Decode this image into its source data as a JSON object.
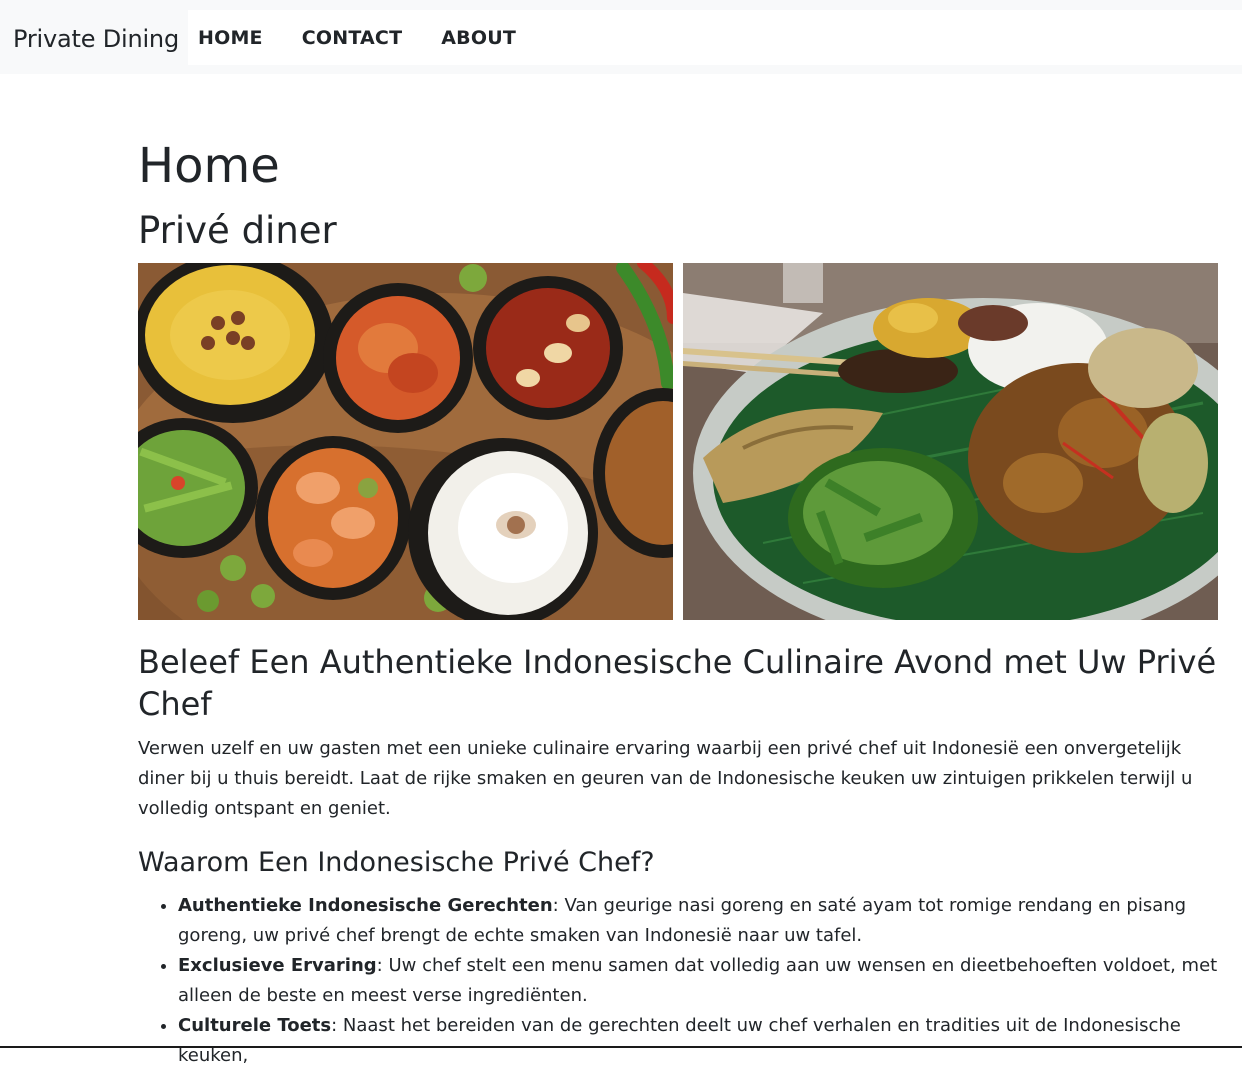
{
  "navbar": {
    "brand": "Private Dining",
    "links": [
      "HOME",
      "CONTACT",
      "ABOUT"
    ]
  },
  "page": {
    "title": "Home",
    "section_title": "Privé diner"
  },
  "images": [
    {
      "name": "indonesian-dishes-bowls-photo"
    },
    {
      "name": "nasi-campur-banana-leaf-photo"
    }
  ],
  "intro": {
    "heading": "Beleef Een Authentieke Indonesische Culinaire Avond met Uw Privé Chef",
    "paragraph": "Verwen uzelf en uw gasten met een unieke culinaire ervaring waarbij een privé chef uit Indonesië een onvergetelijk diner bij u thuis bereidt. Laat de rijke smaken en geuren van de Indonesische keuken uw zintuigen prikkelen terwijl u volledig ontspant en geniet."
  },
  "why": {
    "heading": "Waarom Een Indonesische Privé Chef?",
    "items": [
      {
        "title": "Authentieke Indonesische Gerechten",
        "text": ": Van geurige nasi goreng en saté ayam tot romige rendang en pisang goreng, uw privé chef brengt de echte smaken van Indonesië naar uw tafel."
      },
      {
        "title": "Exclusieve Ervaring",
        "text": ": Uw chef stelt een menu samen dat volledig aan uw wensen en dieetbehoeften voldoet, met alleen de beste en meest verse ingrediënten."
      },
      {
        "title": "Culturele Toets",
        "text": ": Naast het bereiden van de gerechten deelt uw chef verhalen en tradities uit de Indonesische keuken,"
      }
    ]
  },
  "colors": {
    "navbar_bg": "#f8f9fa",
    "text": "#212529",
    "background": "#ffffff"
  }
}
